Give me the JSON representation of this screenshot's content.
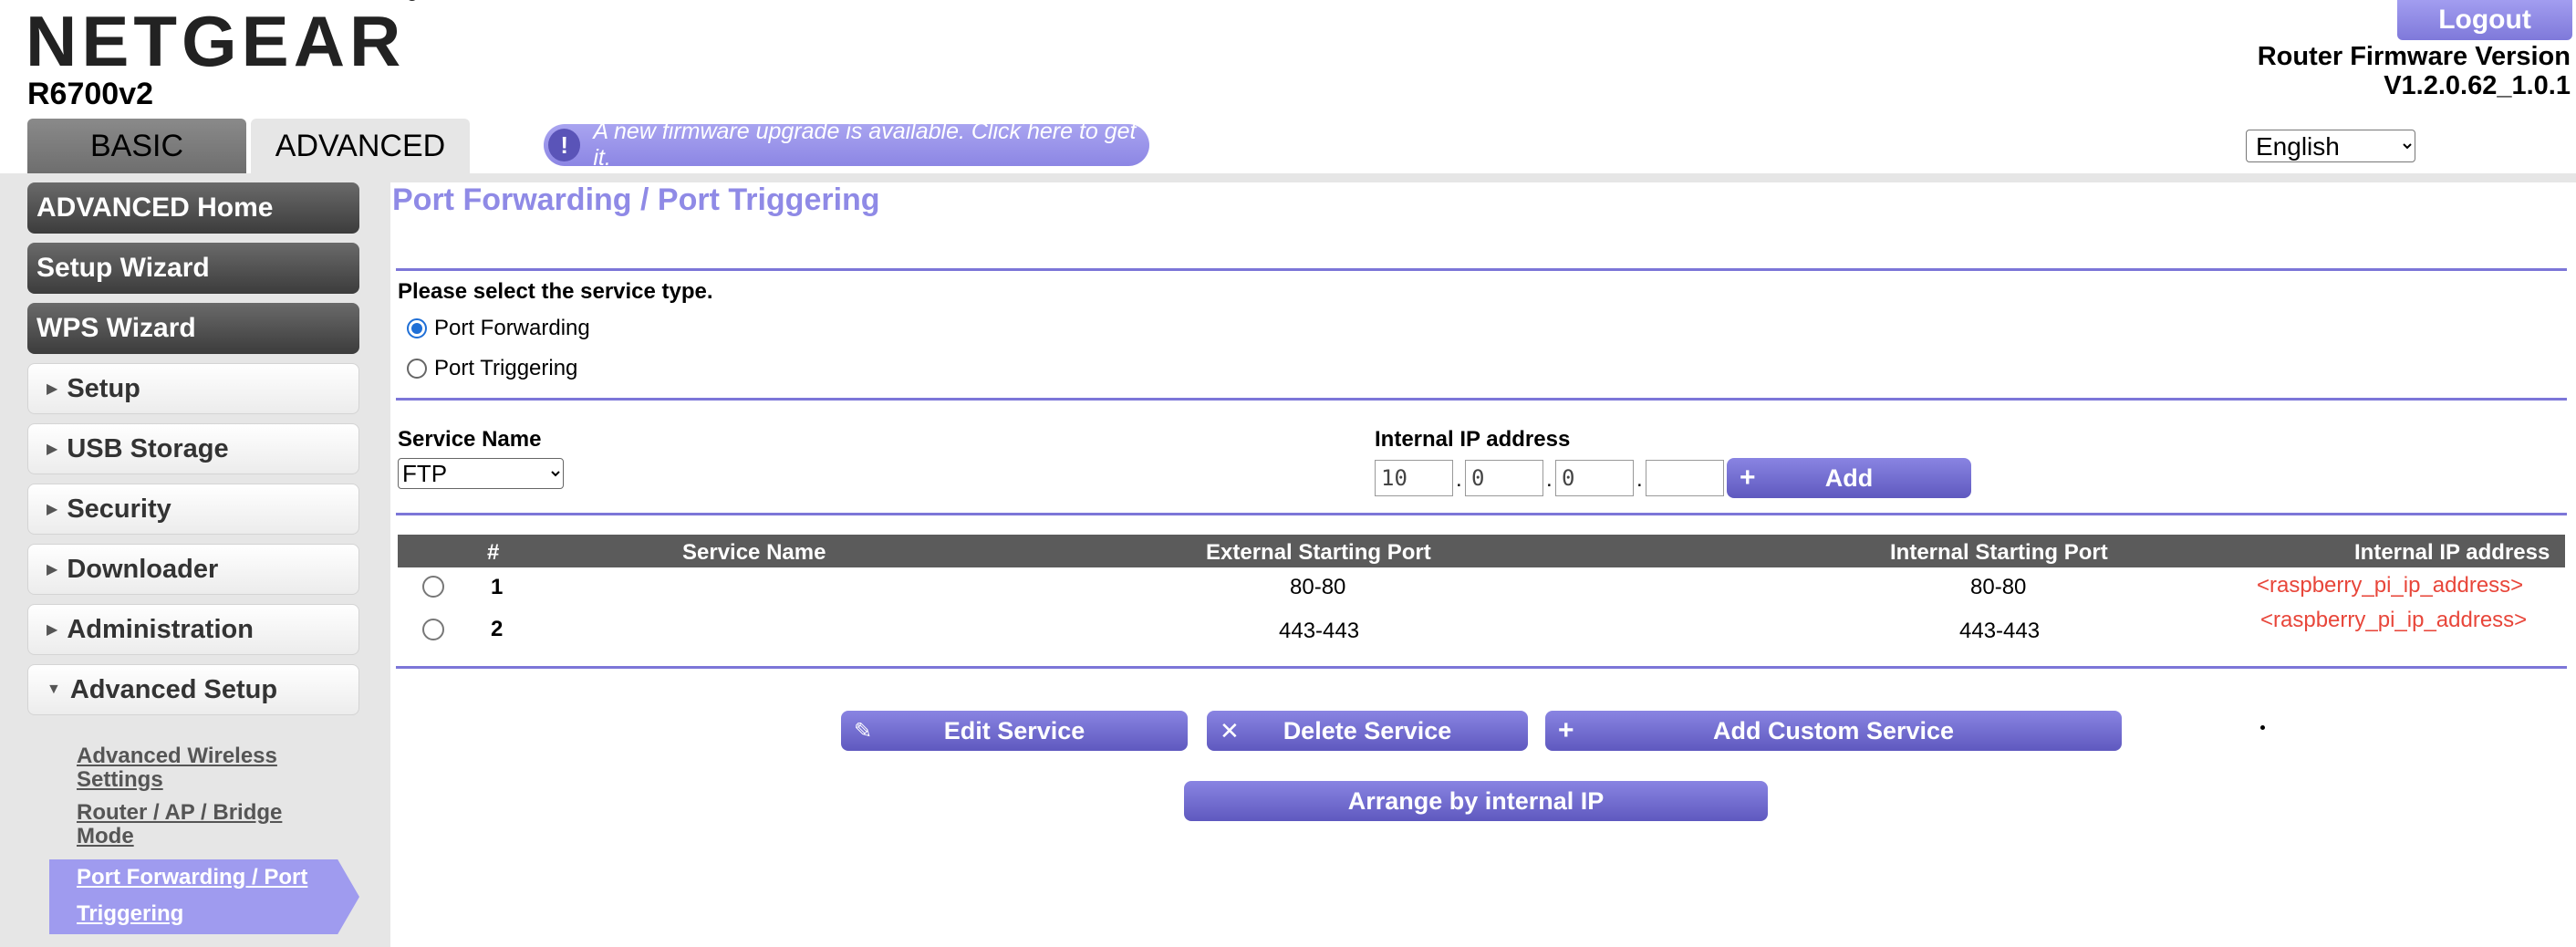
{
  "header": {
    "brand": "NETGEAR",
    "registered_mark": "®",
    "model": "R6700v2",
    "tabs": [
      {
        "label": "BASIC",
        "active": false
      },
      {
        "label": "ADVANCED",
        "active": true
      }
    ],
    "firmware_banner_icon": "!",
    "firmware_banner_text": "A new firmware upgrade is available. Click here to get it.",
    "logout_label": "Logout",
    "firmware_label": "Router Firmware Version",
    "firmware_version": "V1.2.0.62_1.0.1",
    "language": "English"
  },
  "sidebar": {
    "main_items": [
      {
        "label": "ADVANCED Home"
      },
      {
        "label": "Setup Wizard"
      },
      {
        "label": "WPS Wizard"
      }
    ],
    "sections": [
      {
        "label": "Setup",
        "expanded": false
      },
      {
        "label": "USB Storage",
        "expanded": false
      },
      {
        "label": "Security",
        "expanded": false
      },
      {
        "label": "Downloader",
        "expanded": false
      },
      {
        "label": "Administration",
        "expanded": false
      },
      {
        "label": "Advanced Setup",
        "expanded": true
      }
    ],
    "advanced_setup_links": [
      {
        "line1": "Advanced Wireless",
        "line2": "Settings"
      },
      {
        "line1": "Router / AP / Bridge",
        "line2": "Mode"
      }
    ],
    "active_link": {
      "line1": "Port Forwarding / Port",
      "line2": "Triggering"
    }
  },
  "main": {
    "title": "Port Forwarding / Port Triggering",
    "service_type_prompt": "Please select the service type.",
    "service_type_options": [
      {
        "label": "Port Forwarding",
        "checked": true
      },
      {
        "label": "Port Triggering",
        "checked": false
      }
    ],
    "service_name_label": "Service Name",
    "service_name_selected": "FTP",
    "internal_ip_label": "Internal IP address",
    "ip_octets": [
      "10",
      "0",
      "0",
      ""
    ],
    "add_label": "Add",
    "table": {
      "headers": [
        "#",
        "Service Name",
        "External Starting Port",
        "Internal Starting Port",
        "Internal IP address"
      ],
      "rows": [
        {
          "num": "1",
          "service": "",
          "ext_port": "80-80",
          "int_port": "80-80",
          "ip": "<raspberry_pi_ip_address>"
        },
        {
          "num": "2",
          "service": "",
          "ext_port": "443-443",
          "int_port": "443-443",
          "ip": "<raspberry_pi_ip_address>"
        }
      ]
    },
    "edit_label": "Edit Service",
    "delete_label": "Delete Service",
    "add_custom_label": "Add Custom Service",
    "arrange_label": "Arrange by internal IP"
  },
  "icons": {
    "edit": "pencil-icon",
    "delete": "x-icon",
    "add": "plus-icon",
    "banner": "exclamation-icon"
  },
  "colors": {
    "accent": "#8f8ae6",
    "button": "#6e68cc",
    "rule": "#7c76d8",
    "ip_text": "#e8463a",
    "sidebar_dark": "#4a4a4a"
  }
}
